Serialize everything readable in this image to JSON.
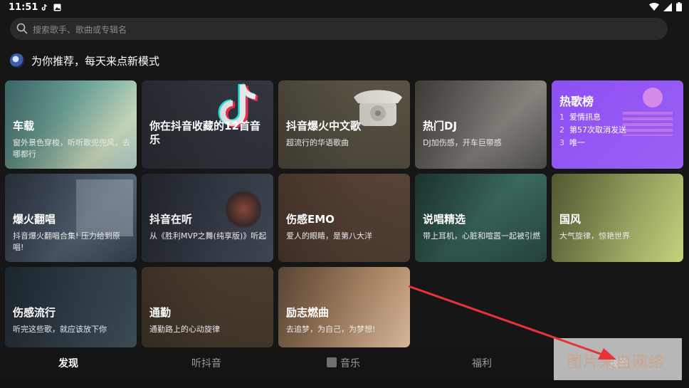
{
  "status": {
    "time": "11:51"
  },
  "search": {
    "placeholder": "搜索歌手、歌曲或专辑名"
  },
  "section": {
    "title": "为你推荐，每天来点新模式"
  },
  "cards": [
    {
      "title": "车载",
      "desc": "窗外景色穿梭，听听歌兜兜风，去哪都行"
    },
    {
      "title": "你在抖音收藏的12首音乐",
      "desc": ""
    },
    {
      "title": "抖音爆火中文歌",
      "desc": "超流行的华语歌曲"
    },
    {
      "title": "热门DJ",
      "desc": "DJ加伤感，开车巨带感"
    },
    {
      "title": "热歌榜",
      "list": [
        {
          "n": "1",
          "t": "爱情訊息"
        },
        {
          "n": "2",
          "t": "第57次取消发送"
        },
        {
          "n": "3",
          "t": "唯一"
        }
      ]
    },
    {
      "title": "爆火翻唱",
      "desc": "抖音爆火翻唱合集! 压力给到原唱!"
    },
    {
      "title": "抖音在听",
      "desc": "从《胜利MVP之舞(纯享版)》听起"
    },
    {
      "title": "伤感EMO",
      "desc": "爱人的眼睛，是第八大洋"
    },
    {
      "title": "说唱精选",
      "desc": "带上耳机，心脏和喧嚣一起被引燃"
    },
    {
      "title": "国风",
      "desc": "大气旋律，惊艳世界"
    },
    {
      "title": "伤感流行",
      "desc": "听完这些歌，就应该放下你"
    },
    {
      "title": "通勤",
      "desc": "通勤路上的心动旋律"
    },
    {
      "title": "励志燃曲",
      "desc": "去追梦，为自己，为梦想!"
    }
  ],
  "tabs": [
    {
      "label": "发现"
    },
    {
      "label": "听抖音"
    },
    {
      "label": "音乐"
    },
    {
      "label": "福利"
    },
    {
      "label": "我的"
    }
  ],
  "watermark": {
    "text": "图片来自网络"
  },
  "colors": {
    "background": "#161616",
    "hot_card": "#8a4df0",
    "arrow": "#e8323a"
  }
}
